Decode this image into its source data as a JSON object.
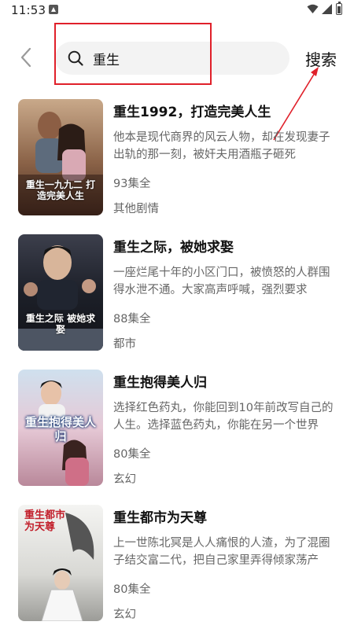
{
  "status_bar": {
    "time": "11:53",
    "icons": [
      "notification-icon",
      "wifi-icon",
      "signal-icon",
      "battery-icon"
    ]
  },
  "header": {
    "back_icon": "chevron-left-icon",
    "search_icon": "search-icon",
    "search_value": "重生",
    "search_button_label": "搜索"
  },
  "colors": {
    "highlight_red": "#e0202a",
    "text_primary": "#111111",
    "text_secondary": "#666666",
    "search_bg": "#f3f3f3"
  },
  "results": [
    {
      "title": "重生1992，打造完美人生",
      "description": "他本是现代商界的风云人物，却在发现妻子出轨的那一刻，被奸夫用酒瓶子砸死",
      "episodes": "93集全",
      "genre": "其他剧情",
      "cover_text": "重生一九九二 打造完美人生"
    },
    {
      "title": "重生之际，被她求娶",
      "description": "一座烂尾十年的小区门口，被愤怒的人群围得水泄不通。大家高声呼喊，强烈要求",
      "episodes": "88集全",
      "genre": "都市",
      "cover_text": "重生之际 被她求娶"
    },
    {
      "title": "重生抱得美人归",
      "description": "选择红色药丸，你能回到10年前改写自己的人生。选择蓝色药丸，你能在另一个世界",
      "episodes": "80集全",
      "genre": "玄幻",
      "cover_text": "重生抱得美人归"
    },
    {
      "title": "重生都市为天尊",
      "description": "上一世陈北冥是人人痛恨的人渣，为了混圈子结交富二代，把自己家里弄得倾家荡产",
      "episodes": "80集全",
      "genre": "玄幻",
      "cover_text": "重生都市为天尊"
    }
  ]
}
